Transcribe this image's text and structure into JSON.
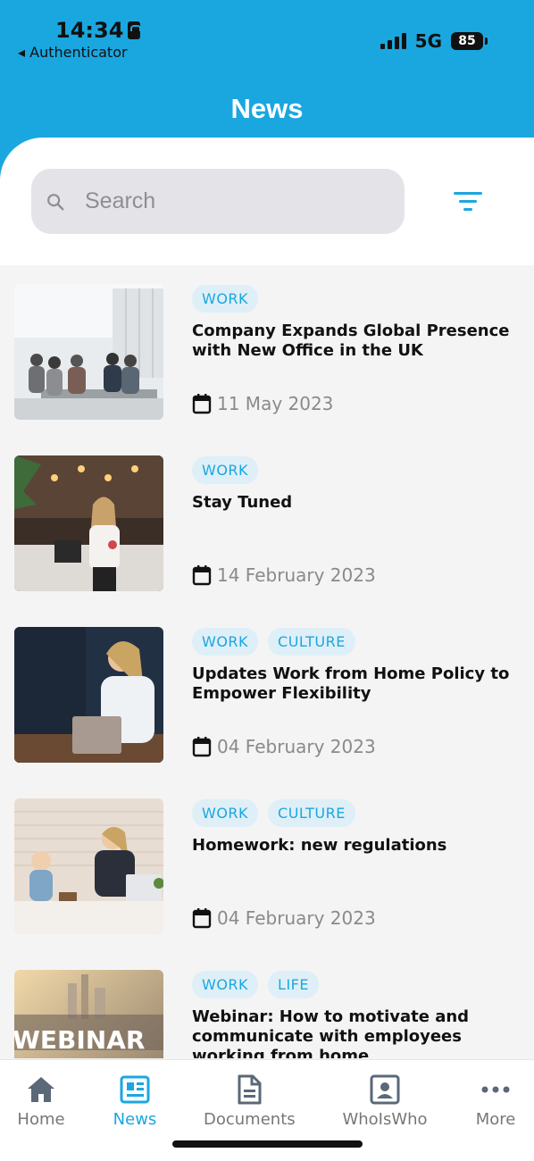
{
  "status_bar": {
    "time": "14:34",
    "back_label": "◂ Authenticator",
    "network": "5G",
    "battery": "85"
  },
  "header": {
    "title": "News"
  },
  "search": {
    "placeholder": "Search"
  },
  "news": [
    {
      "tags": [
        "WORK"
      ],
      "title": "Company Expands Global Presence with New Office in the UK",
      "date": "11 May 2023",
      "image": "office-meeting-photo"
    },
    {
      "tags": [
        "WORK"
      ],
      "title": "Stay Tuned",
      "date": "14 February 2023",
      "image": "cafe-woman-photo"
    },
    {
      "tags": [
        "WORK",
        "CULTURE"
      ],
      "title": "Updates Work from Home Policy to Empower Flexibility",
      "date": "04 February 2023",
      "image": "woman-laptop-photo"
    },
    {
      "tags": [
        "WORK",
        "CULTURE"
      ],
      "title": "Homework: new regulations",
      "date": "04 February 2023",
      "image": "mother-child-desk-photo"
    },
    {
      "tags": [
        "WORK",
        "LIFE"
      ],
      "title": "Webinar: How to motivate and communicate with employees working from home",
      "date": "",
      "image": "webinar-photo",
      "image_text": "WEBINAR"
    }
  ],
  "bottom_nav": [
    {
      "label": "Home",
      "icon": "home-icon",
      "active": false
    },
    {
      "label": "News",
      "icon": "news-icon",
      "active": true
    },
    {
      "label": "Documents",
      "icon": "document-icon",
      "active": false
    },
    {
      "label": "WhoIsWho",
      "icon": "contact-card-icon",
      "active": false
    },
    {
      "label": "More",
      "icon": "more-dots-icon",
      "active": false
    }
  ],
  "colors": {
    "accent": "#1aa7e0",
    "tag_bg": "#dfeff7"
  }
}
